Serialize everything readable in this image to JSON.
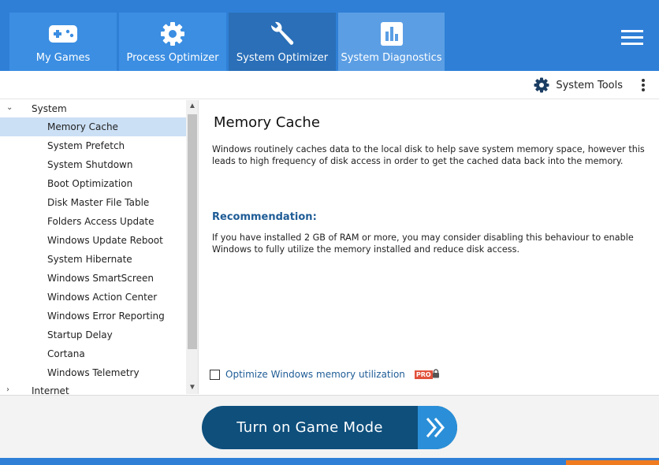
{
  "header": {
    "tabs": [
      {
        "label": "My Games",
        "icon": "gamepad-icon"
      },
      {
        "label": "Process Optimizer",
        "icon": "gear-icon"
      },
      {
        "label": "System Optimizer",
        "icon": "wrench-icon"
      },
      {
        "label": "System Diagnostics",
        "icon": "bar-chart-icon"
      }
    ],
    "active_tab": "System Optimizer"
  },
  "toolbar": {
    "system_tools_label": "System Tools"
  },
  "sidebar": {
    "groups": [
      {
        "label": "System",
        "expanded": true
      },
      {
        "label": "Internet",
        "expanded": false
      }
    ],
    "items": [
      "Memory Cache",
      "System Prefetch",
      "System Shutdown",
      "Boot Optimization",
      "Disk Master File Table",
      "Folders Access Update",
      "Windows Update Reboot",
      "System Hibernate",
      "Windows SmartScreen",
      "Windows Action Center",
      "Windows Error Reporting",
      "Startup Delay",
      "Cortana",
      "Windows Telemetry"
    ],
    "selected": "Memory Cache"
  },
  "content": {
    "title": "Memory Cache",
    "description": "Windows routinely caches data to the local disk to help save system memory space, however this leads to high frequency of disk access in order to get the cached data back into the memory.",
    "recommendation_title": "Recommendation:",
    "recommendation_text": "If you have installed 2 GB of RAM or more, you may consider disabling this behaviour to enable Windows to fully utilize the memory installed and reduce disk access.",
    "option_label": "Optimize Windows memory utilization",
    "option_checked": false,
    "pro_badge": "PRO"
  },
  "bottom": {
    "game_mode_label": "Turn on Game Mode"
  },
  "colors": {
    "header_blue": "#2f7fd6",
    "button_dark": "#0e4f7c",
    "button_light": "#2a8fd8",
    "selected_row": "#cce0f5",
    "link_blue": "#1e5c96",
    "pro_red": "#e2513b",
    "footer_orange": "#f07b1f"
  }
}
